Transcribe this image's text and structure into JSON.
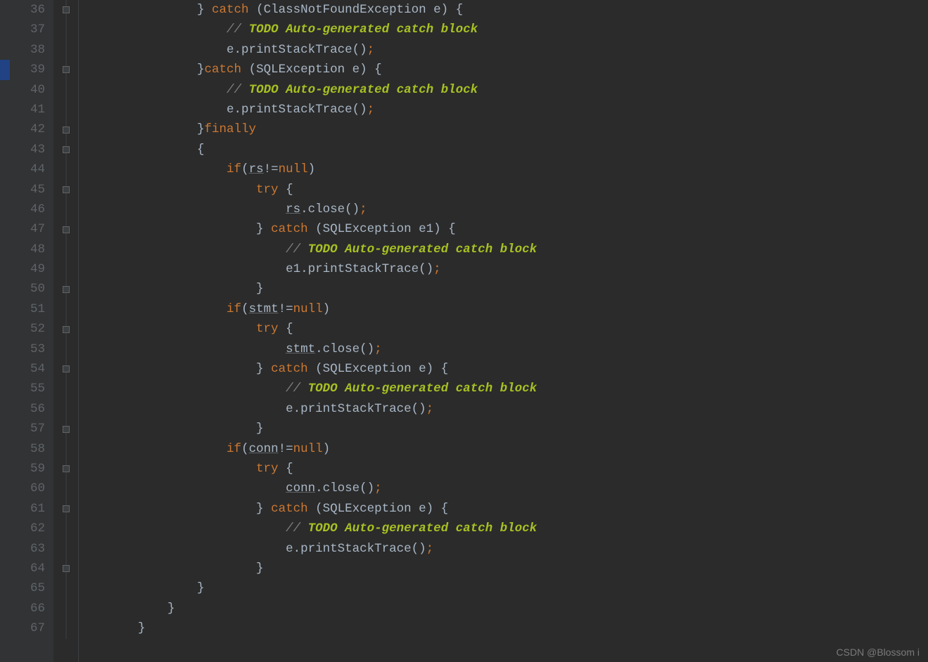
{
  "watermark": "CSDN @Blossom i",
  "lines": [
    {
      "n": 36,
      "indent": 4,
      "tokens": [
        {
          "t": "} ",
          "c": "punct"
        },
        {
          "t": "catch ",
          "c": "kw"
        },
        {
          "t": "(ClassNotFoundException e) {",
          "c": "punct"
        }
      ]
    },
    {
      "n": 37,
      "indent": 5,
      "tokens": [
        {
          "t": "// ",
          "c": "comment"
        },
        {
          "t": "TODO Auto-generated catch block",
          "c": "todo"
        }
      ]
    },
    {
      "n": 38,
      "indent": 5,
      "tokens": [
        {
          "t": "e.printStackTrace()",
          "c": "ident"
        },
        {
          "t": ";",
          "c": "semi"
        }
      ]
    },
    {
      "n": 39,
      "indent": 4,
      "tokens": [
        {
          "t": "}",
          "c": "punct"
        },
        {
          "t": "catch ",
          "c": "kw"
        },
        {
          "t": "(SQLException e) {",
          "c": "punct"
        }
      ],
      "bp": true
    },
    {
      "n": 40,
      "indent": 5,
      "tokens": [
        {
          "t": "// ",
          "c": "comment"
        },
        {
          "t": "TODO Auto-generated catch block",
          "c": "todo"
        }
      ]
    },
    {
      "n": 41,
      "indent": 5,
      "tokens": [
        {
          "t": "e.printStackTrace()",
          "c": "ident"
        },
        {
          "t": ";",
          "c": "semi"
        }
      ]
    },
    {
      "n": 42,
      "indent": 4,
      "tokens": [
        {
          "t": "}",
          "c": "punct"
        },
        {
          "t": "finally",
          "c": "kw"
        }
      ]
    },
    {
      "n": 43,
      "indent": 4,
      "tokens": [
        {
          "t": "{",
          "c": "punct"
        }
      ]
    },
    {
      "n": 44,
      "indent": 5,
      "tokens": [
        {
          "t": "if",
          "c": "kw"
        },
        {
          "t": "(",
          "c": "punct"
        },
        {
          "t": "rs",
          "c": "field"
        },
        {
          "t": "!=",
          "c": "punct"
        },
        {
          "t": "null",
          "c": "kw"
        },
        {
          "t": ")",
          "c": "punct"
        }
      ]
    },
    {
      "n": 45,
      "indent": 6,
      "tokens": [
        {
          "t": "try ",
          "c": "kw"
        },
        {
          "t": "{",
          "c": "punct"
        }
      ]
    },
    {
      "n": 46,
      "indent": 7,
      "tokens": [
        {
          "t": "rs",
          "c": "field"
        },
        {
          "t": ".close()",
          "c": "ident"
        },
        {
          "t": ";",
          "c": "semi"
        }
      ]
    },
    {
      "n": 47,
      "indent": 6,
      "tokens": [
        {
          "t": "} ",
          "c": "punct"
        },
        {
          "t": "catch ",
          "c": "kw"
        },
        {
          "t": "(SQLException e1) {",
          "c": "punct"
        }
      ]
    },
    {
      "n": 48,
      "indent": 7,
      "tokens": [
        {
          "t": "// ",
          "c": "comment"
        },
        {
          "t": "TODO Auto-generated catch block",
          "c": "todo"
        }
      ]
    },
    {
      "n": 49,
      "indent": 7,
      "tokens": [
        {
          "t": "e1.printStackTrace()",
          "c": "ident"
        },
        {
          "t": ";",
          "c": "semi"
        }
      ]
    },
    {
      "n": 50,
      "indent": 6,
      "tokens": [
        {
          "t": "}",
          "c": "punct"
        }
      ]
    },
    {
      "n": 51,
      "indent": 5,
      "tokens": [
        {
          "t": "if",
          "c": "kw"
        },
        {
          "t": "(",
          "c": "punct"
        },
        {
          "t": "stmt",
          "c": "field"
        },
        {
          "t": "!=",
          "c": "punct"
        },
        {
          "t": "null",
          "c": "kw"
        },
        {
          "t": ")",
          "c": "punct"
        }
      ]
    },
    {
      "n": 52,
      "indent": 6,
      "tokens": [
        {
          "t": "try ",
          "c": "kw"
        },
        {
          "t": "{",
          "c": "punct"
        }
      ]
    },
    {
      "n": 53,
      "indent": 7,
      "tokens": [
        {
          "t": "stmt",
          "c": "field"
        },
        {
          "t": ".close()",
          "c": "ident"
        },
        {
          "t": ";",
          "c": "semi"
        }
      ]
    },
    {
      "n": 54,
      "indent": 6,
      "tokens": [
        {
          "t": "} ",
          "c": "punct"
        },
        {
          "t": "catch ",
          "c": "kw"
        },
        {
          "t": "(SQLException e) {",
          "c": "punct"
        }
      ]
    },
    {
      "n": 55,
      "indent": 7,
      "tokens": [
        {
          "t": "// ",
          "c": "comment"
        },
        {
          "t": "TODO Auto-generated catch block",
          "c": "todo"
        }
      ]
    },
    {
      "n": 56,
      "indent": 7,
      "tokens": [
        {
          "t": "e.printStackTrace()",
          "c": "ident"
        },
        {
          "t": ";",
          "c": "semi"
        }
      ]
    },
    {
      "n": 57,
      "indent": 6,
      "tokens": [
        {
          "t": "}",
          "c": "punct"
        }
      ]
    },
    {
      "n": 58,
      "indent": 5,
      "tokens": [
        {
          "t": "if",
          "c": "kw"
        },
        {
          "t": "(",
          "c": "punct"
        },
        {
          "t": "conn",
          "c": "field"
        },
        {
          "t": "!=",
          "c": "punct"
        },
        {
          "t": "null",
          "c": "kw"
        },
        {
          "t": ")",
          "c": "punct"
        }
      ]
    },
    {
      "n": 59,
      "indent": 6,
      "tokens": [
        {
          "t": "try ",
          "c": "kw"
        },
        {
          "t": "{",
          "c": "punct"
        }
      ]
    },
    {
      "n": 60,
      "indent": 7,
      "tokens": [
        {
          "t": "conn",
          "c": "field"
        },
        {
          "t": ".close()",
          "c": "ident"
        },
        {
          "t": ";",
          "c": "semi"
        }
      ]
    },
    {
      "n": 61,
      "indent": 6,
      "tokens": [
        {
          "t": "} ",
          "c": "punct"
        },
        {
          "t": "catch ",
          "c": "kw"
        },
        {
          "t": "(SQLException e) {",
          "c": "punct"
        }
      ]
    },
    {
      "n": 62,
      "indent": 7,
      "tokens": [
        {
          "t": "// ",
          "c": "comment"
        },
        {
          "t": "TODO Auto-generated catch block",
          "c": "todo"
        }
      ]
    },
    {
      "n": 63,
      "indent": 7,
      "tokens": [
        {
          "t": "e.printStackTrace()",
          "c": "ident"
        },
        {
          "t": ";",
          "c": "semi"
        }
      ]
    },
    {
      "n": 64,
      "indent": 6,
      "tokens": [
        {
          "t": "}",
          "c": "punct"
        }
      ]
    },
    {
      "n": 65,
      "indent": 4,
      "tokens": [
        {
          "t": "}",
          "c": "punct"
        }
      ]
    },
    {
      "n": 66,
      "indent": 3,
      "tokens": [
        {
          "t": "}",
          "c": "punct"
        }
      ]
    },
    {
      "n": 67,
      "indent": 2,
      "tokens": [
        {
          "t": "}",
          "c": "punct"
        }
      ]
    }
  ]
}
